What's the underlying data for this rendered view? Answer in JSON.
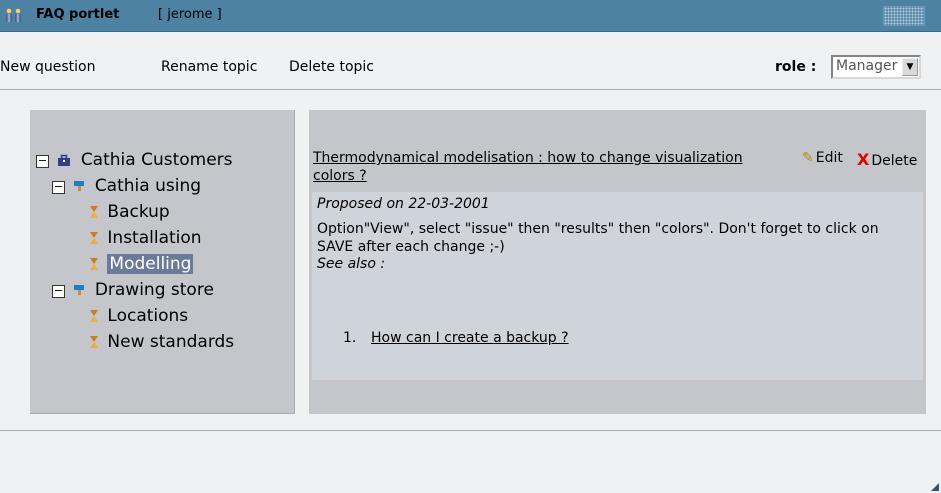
{
  "window": {
    "app_name": "FAQ portlet",
    "user": "[ jerome ]"
  },
  "toolbar": {
    "new_question": "New question",
    "rename_topic": "Rename topic",
    "delete_topic": "Delete topic",
    "role_label": "role :",
    "role_value": "Manager"
  },
  "tree": {
    "root": "Cathia Customers",
    "groups": [
      {
        "label": "Cathia using",
        "items": [
          "Backup",
          "Installation",
          "Modelling"
        ]
      },
      {
        "label": "Drawing store",
        "items": [
          "Locations",
          "New standards"
        ]
      }
    ],
    "selected": "Modelling"
  },
  "faq": {
    "question": "Thermodynamical modelisation : how to change visualization colors ?",
    "edit_label": "Edit",
    "delete_label": "Delete",
    "proposed": "Proposed on 22-03-2001",
    "answer": "Option\"View\", select \"issue\" then \"results\" then \"colors\". Don't forget to click on SAVE after each change ;-)",
    "see_also": "See also :",
    "references": [
      {
        "num": "1.",
        "text": "How can I create a backup ?"
      }
    ]
  },
  "colors": {
    "titlebar": "#4e82a3",
    "panel": "#c4c6cc",
    "selection": "#6b7a98"
  }
}
